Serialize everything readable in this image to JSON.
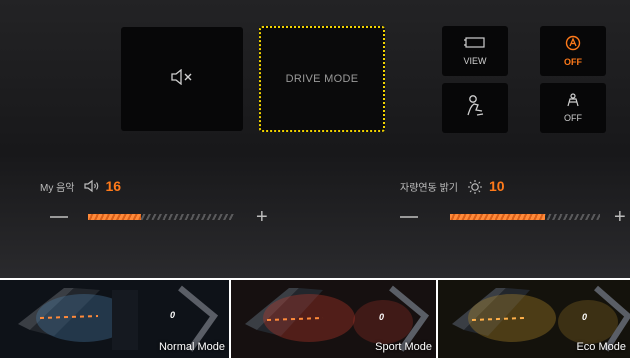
{
  "drive_mode_panel": {
    "mute_tile": {
      "icon": "speaker-mute-icon"
    },
    "drive_mode_tile": {
      "label": "DRIVE MODE",
      "focus_color": "#f2d400"
    },
    "view_tile": {
      "icon": "camera-view-icon",
      "label": "VIEW"
    },
    "auto_hold_tile": {
      "icon": "auto-hold-icon",
      "label": "OFF",
      "label_color": "#ff7a1a"
    },
    "person_tile": {
      "icon": "person-seat-icon"
    },
    "seat_tile": {
      "icon": "seat-massage-icon",
      "label": "OFF"
    }
  },
  "music_volume": {
    "label": "My 음악",
    "icon": "speaker-volume-icon",
    "value": "16",
    "level_fraction": 0.36
  },
  "ambient_brightness": {
    "label": "자량연동 밝기",
    "icon": "sun-brightness-icon",
    "value": "10",
    "level_fraction": 0.63
  },
  "accent_color": "#ff7a1a",
  "mode_previews": [
    {
      "label": "Normal Mode",
      "glow": "#4a7fa8",
      "speed": "0"
    },
    {
      "label": "Sport Mode",
      "glow": "#c0392b",
      "speed": "0"
    },
    {
      "label": "Eco Mode",
      "glow": "#b58b2a",
      "speed": "0"
    }
  ]
}
